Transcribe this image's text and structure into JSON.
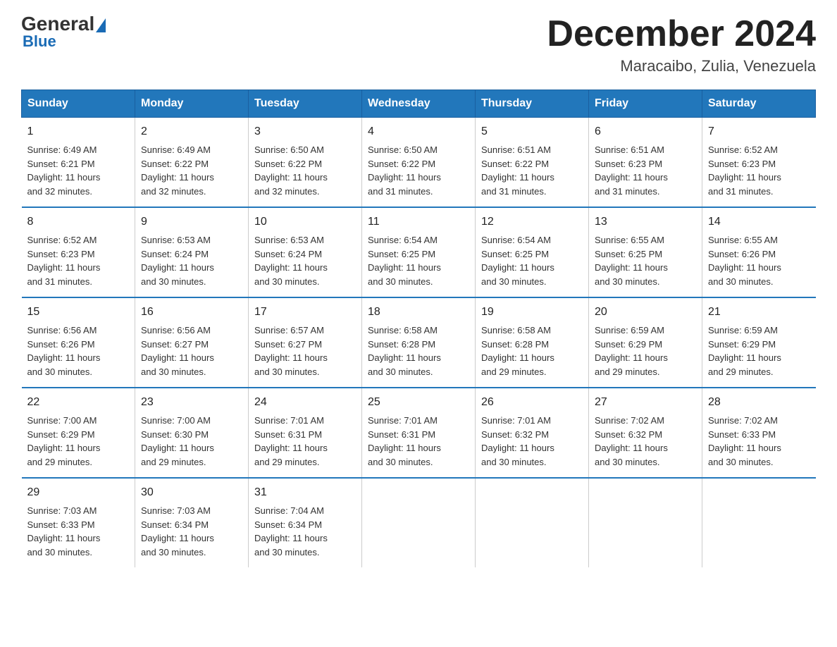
{
  "logo": {
    "general": "General",
    "blue": "Blue"
  },
  "header": {
    "title": "December 2024",
    "subtitle": "Maracaibo, Zulia, Venezuela"
  },
  "columns": [
    "Sunday",
    "Monday",
    "Tuesday",
    "Wednesday",
    "Thursday",
    "Friday",
    "Saturday"
  ],
  "weeks": [
    [
      {
        "day": "1",
        "sunrise": "6:49 AM",
        "sunset": "6:21 PM",
        "daylight": "11 hours and 32 minutes."
      },
      {
        "day": "2",
        "sunrise": "6:49 AM",
        "sunset": "6:22 PM",
        "daylight": "11 hours and 32 minutes."
      },
      {
        "day": "3",
        "sunrise": "6:50 AM",
        "sunset": "6:22 PM",
        "daylight": "11 hours and 32 minutes."
      },
      {
        "day": "4",
        "sunrise": "6:50 AM",
        "sunset": "6:22 PM",
        "daylight": "11 hours and 31 minutes."
      },
      {
        "day": "5",
        "sunrise": "6:51 AM",
        "sunset": "6:22 PM",
        "daylight": "11 hours and 31 minutes."
      },
      {
        "day": "6",
        "sunrise": "6:51 AM",
        "sunset": "6:23 PM",
        "daylight": "11 hours and 31 minutes."
      },
      {
        "day": "7",
        "sunrise": "6:52 AM",
        "sunset": "6:23 PM",
        "daylight": "11 hours and 31 minutes."
      }
    ],
    [
      {
        "day": "8",
        "sunrise": "6:52 AM",
        "sunset": "6:23 PM",
        "daylight": "11 hours and 31 minutes."
      },
      {
        "day": "9",
        "sunrise": "6:53 AM",
        "sunset": "6:24 PM",
        "daylight": "11 hours and 30 minutes."
      },
      {
        "day": "10",
        "sunrise": "6:53 AM",
        "sunset": "6:24 PM",
        "daylight": "11 hours and 30 minutes."
      },
      {
        "day": "11",
        "sunrise": "6:54 AM",
        "sunset": "6:25 PM",
        "daylight": "11 hours and 30 minutes."
      },
      {
        "day": "12",
        "sunrise": "6:54 AM",
        "sunset": "6:25 PM",
        "daylight": "11 hours and 30 minutes."
      },
      {
        "day": "13",
        "sunrise": "6:55 AM",
        "sunset": "6:25 PM",
        "daylight": "11 hours and 30 minutes."
      },
      {
        "day": "14",
        "sunrise": "6:55 AM",
        "sunset": "6:26 PM",
        "daylight": "11 hours and 30 minutes."
      }
    ],
    [
      {
        "day": "15",
        "sunrise": "6:56 AM",
        "sunset": "6:26 PM",
        "daylight": "11 hours and 30 minutes."
      },
      {
        "day": "16",
        "sunrise": "6:56 AM",
        "sunset": "6:27 PM",
        "daylight": "11 hours and 30 minutes."
      },
      {
        "day": "17",
        "sunrise": "6:57 AM",
        "sunset": "6:27 PM",
        "daylight": "11 hours and 30 minutes."
      },
      {
        "day": "18",
        "sunrise": "6:58 AM",
        "sunset": "6:28 PM",
        "daylight": "11 hours and 30 minutes."
      },
      {
        "day": "19",
        "sunrise": "6:58 AM",
        "sunset": "6:28 PM",
        "daylight": "11 hours and 29 minutes."
      },
      {
        "day": "20",
        "sunrise": "6:59 AM",
        "sunset": "6:29 PM",
        "daylight": "11 hours and 29 minutes."
      },
      {
        "day": "21",
        "sunrise": "6:59 AM",
        "sunset": "6:29 PM",
        "daylight": "11 hours and 29 minutes."
      }
    ],
    [
      {
        "day": "22",
        "sunrise": "7:00 AM",
        "sunset": "6:29 PM",
        "daylight": "11 hours and 29 minutes."
      },
      {
        "day": "23",
        "sunrise": "7:00 AM",
        "sunset": "6:30 PM",
        "daylight": "11 hours and 29 minutes."
      },
      {
        "day": "24",
        "sunrise": "7:01 AM",
        "sunset": "6:31 PM",
        "daylight": "11 hours and 29 minutes."
      },
      {
        "day": "25",
        "sunrise": "7:01 AM",
        "sunset": "6:31 PM",
        "daylight": "11 hours and 30 minutes."
      },
      {
        "day": "26",
        "sunrise": "7:01 AM",
        "sunset": "6:32 PM",
        "daylight": "11 hours and 30 minutes."
      },
      {
        "day": "27",
        "sunrise": "7:02 AM",
        "sunset": "6:32 PM",
        "daylight": "11 hours and 30 minutes."
      },
      {
        "day": "28",
        "sunrise": "7:02 AM",
        "sunset": "6:33 PM",
        "daylight": "11 hours and 30 minutes."
      }
    ],
    [
      {
        "day": "29",
        "sunrise": "7:03 AM",
        "sunset": "6:33 PM",
        "daylight": "11 hours and 30 minutes."
      },
      {
        "day": "30",
        "sunrise": "7:03 AM",
        "sunset": "6:34 PM",
        "daylight": "11 hours and 30 minutes."
      },
      {
        "day": "31",
        "sunrise": "7:04 AM",
        "sunset": "6:34 PM",
        "daylight": "11 hours and 30 minutes."
      },
      null,
      null,
      null,
      null
    ]
  ],
  "labels": {
    "sunrise": "Sunrise:",
    "sunset": "Sunset:",
    "daylight": "Daylight:"
  }
}
